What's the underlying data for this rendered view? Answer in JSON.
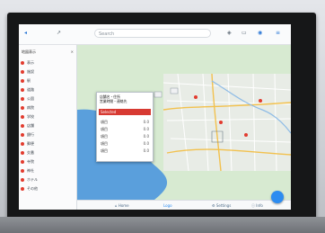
{
  "app": {
    "search_placeholder": "Search"
  },
  "menu": {
    "header": "地図表示",
    "items": [
      {
        "label": "表示",
        "color": "#e23b2e"
      },
      {
        "label": "施設",
        "color": "#e23b2e"
      },
      {
        "label": "駅",
        "color": "#e23b2e"
      },
      {
        "label": "道路",
        "color": "#e23b2e"
      },
      {
        "label": "公園",
        "color": "#e23b2e"
      },
      {
        "label": "病院",
        "color": "#e23b2e"
      },
      {
        "label": "学校",
        "color": "#e23b2e"
      },
      {
        "label": "店舗",
        "color": "#e23b2e"
      },
      {
        "label": "銀行",
        "color": "#e23b2e"
      },
      {
        "label": "郵便",
        "color": "#e23b2e"
      },
      {
        "label": "交番",
        "color": "#e23b2e"
      },
      {
        "label": "寺院",
        "color": "#e23b2e"
      },
      {
        "label": "神社",
        "color": "#e23b2e"
      },
      {
        "label": "ホテル",
        "color": "#e23b2e"
      },
      {
        "label": "その他",
        "color": "#e23b2e"
      }
    ]
  },
  "popup": {
    "title_line1": "店舗名・住所",
    "title_line2": "営業時間・連絡先",
    "selected": "Selected",
    "rows": [
      {
        "label": "項目",
        "value": "0.0"
      },
      {
        "label": "項目",
        "value": "0.0"
      },
      {
        "label": "項目",
        "value": "0.0"
      },
      {
        "label": "項目",
        "value": "0.0"
      },
      {
        "label": "項目",
        "value": "0.0"
      }
    ]
  },
  "bottom": {
    "tabs": [
      "Home",
      "Logo",
      "Settings",
      "Info"
    ]
  },
  "colors": {
    "accent_blue": "#2d8cf0",
    "alert_red": "#d73a32",
    "water": "#5a9fdc",
    "land": "#d7ead1"
  }
}
